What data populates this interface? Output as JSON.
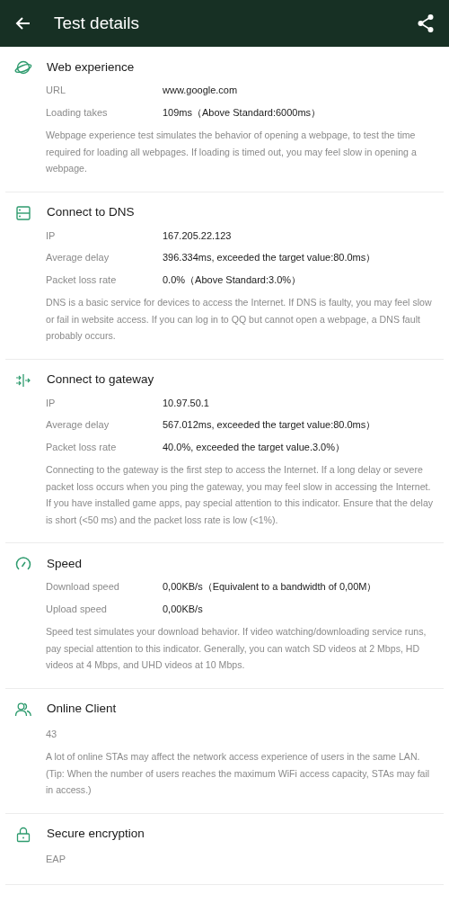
{
  "header": {
    "title": "Test details"
  },
  "sections": [
    {
      "title": "Web experience",
      "rows": [
        {
          "label": "URL",
          "value": "www.google.com"
        },
        {
          "label": "Loading takes",
          "value": "109ms（Above Standard:6000ms）"
        }
      ],
      "description": [
        "Webpage experience test simulates the behavior of opening a webpage, to test the time required for loading all webpages. If loading is timed out, you may feel slow in opening a webpage."
      ]
    },
    {
      "title": "Connect to DNS",
      "rows": [
        {
          "label": "IP",
          "value": "167.205.22.123"
        },
        {
          "label": "Average delay",
          "value": "396.334ms, exceeded the target value:80.0ms）"
        },
        {
          "label": "Packet loss rate",
          "value": "0.0%（Above Standard:3.0%）"
        }
      ],
      "description": [
        "DNS is a basic service for devices to access the Internet. If DNS is faulty, you may feel slow or fail in website access. If you can log in to QQ but cannot open a webpage, a DNS fault probably occurs."
      ]
    },
    {
      "title": "Connect to gateway",
      "rows": [
        {
          "label": "IP",
          "value": "10.97.50.1"
        },
        {
          "label": "Average delay",
          "value": "567.012ms, exceeded the target value:80.0ms）"
        },
        {
          "label": "Packet loss rate",
          "value": "40.0%, exceeded the target value.3.0%）"
        }
      ],
      "description": [
        "Connecting to the gateway is the first step to access the Internet. If a long delay or severe packet loss occurs when you ping the gateway, you may feel slow in accessing the Internet. If you have installed game apps, pay special attention to this indicator. Ensure that the delay is short (<50 ms) and the packet loss rate is low (<1%)."
      ]
    },
    {
      "title": "Speed",
      "rows": [
        {
          "label": "Download speed",
          "value": "0,00KB/s（Equivalent to a bandwidth of 0,00M）"
        },
        {
          "label": "Upload speed",
          "value": "0,00KB/s"
        }
      ],
      "description": [
        "Speed test simulates your download behavior. If video watching/downloading service runs, pay special attention to this indicator. Generally, you can watch SD videos at 2 Mbps, HD videos at 4 Mbps, and UHD videos at 10 Mbps."
      ]
    },
    {
      "title": "Online Client",
      "value": "43",
      "description": [
        "A lot of online STAs may affect the network access experience of users in the same LAN.",
        "(Tip: When the number of users reaches the maximum WiFi access capacity, STAs may fail in access.)"
      ]
    },
    {
      "title": "Secure encryption",
      "value": "EAP"
    }
  ]
}
